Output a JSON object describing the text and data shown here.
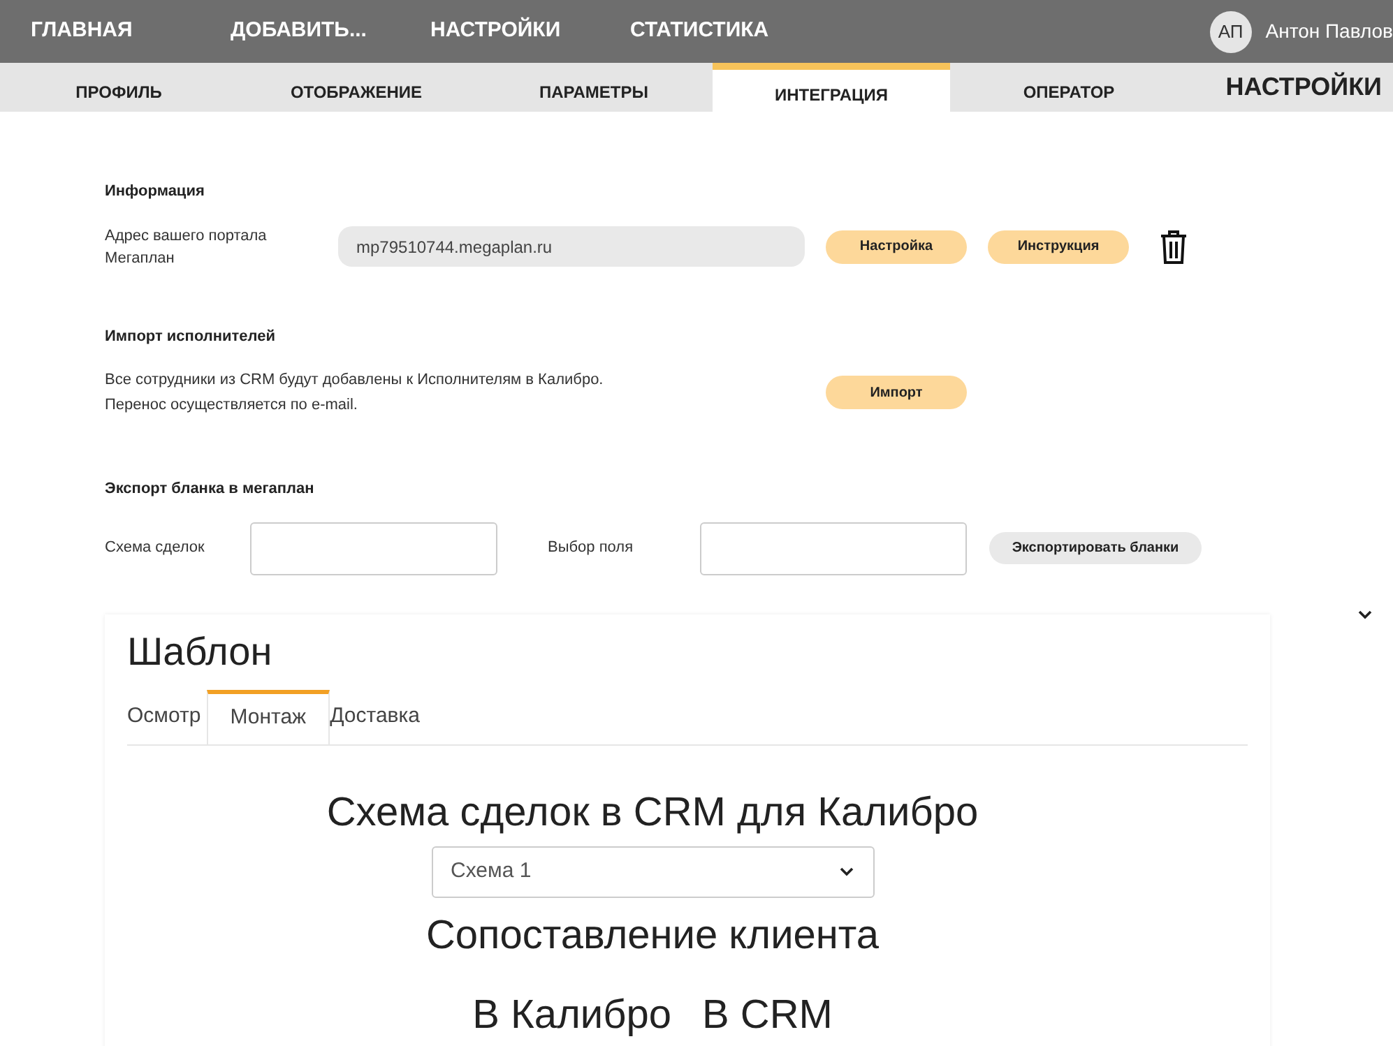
{
  "top_nav": {
    "items": [
      "ГЛАВНАЯ",
      "ДОБАВИТЬ...",
      "НАСТРОЙКИ",
      "СТАТИСТИКА"
    ],
    "user": {
      "initials": "АП",
      "name": "Антон Павлов"
    }
  },
  "sub_tabs": [
    {
      "label": "ПРОФИЛЬ",
      "selected": false
    },
    {
      "label": "ОТОБРАЖЕНИЕ",
      "selected": false
    },
    {
      "label": "ПАРАМЕТРЫ",
      "selected": false
    },
    {
      "label": "ИНТЕГРАЦИЯ",
      "selected": true
    },
    {
      "label": "ОПЕРАТОР",
      "selected": false
    }
  ],
  "page_title": "НАСТРОЙКИ",
  "info": {
    "heading": "Информация",
    "label": "Адрес вашего портала Мегаплан",
    "value": "mp79510744.megaplan.ru",
    "buttons": [
      "Настройка",
      "Инструкция"
    ]
  },
  "import": {
    "heading": "Импорт исполнителей",
    "text": "Все сотрудники из CRM будут добавлены к Исполнителям в Калибро. Перенос осуществляется по e-mail.",
    "button": "Импорт"
  },
  "export": {
    "heading": "Экспорт бланка в мегаплан",
    "field_1_label": "Схема сделок",
    "field_2_label": "Выбор поля",
    "button": "Экспортировать бланки"
  },
  "template": {
    "title": "Шаблон",
    "tabs": [
      {
        "label": "Осмотр",
        "selected": false
      },
      {
        "label": "Монтаж",
        "selected": true
      },
      {
        "label": "Доставка",
        "selected": false
      }
    ],
    "scheme_heading": "Схема сделок в CRM для Калибро",
    "scheme_value": "Схема 1",
    "match_heading": "Сопоставление клиента",
    "columns": [
      "В Калибро",
      "В CRM"
    ]
  }
}
